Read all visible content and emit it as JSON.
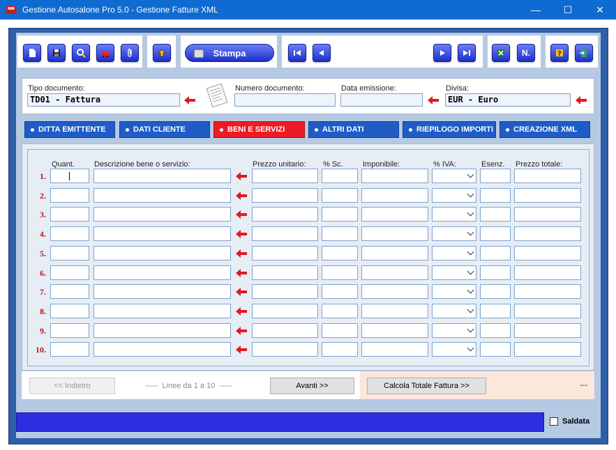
{
  "window": {
    "title": "Gestione Autosalone Pro 5.0 - Gestione Fatture XML",
    "minimize": "—",
    "maximize": "☐",
    "close": "✕"
  },
  "toolbar": {
    "print_label": "Stampa",
    "icons": [
      "new-document",
      "save",
      "search",
      "car",
      "attachment",
      "home-up",
      "first-record",
      "previous-record",
      "next-record",
      "last-record",
      "excel-export",
      "numbering",
      "help",
      "exit"
    ],
    "numbering_label": "N."
  },
  "header": {
    "doc_type": {
      "label": "Tipo documento:",
      "value": "TD01 - Fattura"
    },
    "doc_number": {
      "label": "Numero documento:",
      "value": ""
    },
    "issue_date": {
      "label": "Data emissione:",
      "value": ""
    },
    "currency": {
      "label": "Divisa:",
      "value": "EUR - Euro"
    }
  },
  "tabs": [
    {
      "label": "DITTA EMITTENTE",
      "active": false
    },
    {
      "label": "DATI CLIENTE",
      "active": false
    },
    {
      "label": "BENI E SERVIZI",
      "active": true
    },
    {
      "label": "ALTRI DATI",
      "active": false
    },
    {
      "label": "RIEPILOGO IMPORTI",
      "active": false
    },
    {
      "label": "CREAZIONE XML",
      "active": false
    }
  ],
  "grid": {
    "columns": {
      "quantity": "Quant.",
      "description": "Descrizione bene o servizio:",
      "unit_price": "Prezzo unitario:",
      "discount": "% Sc.",
      "taxable": "Imponibile:",
      "vat": "% IVA:",
      "exempt": "Esenz.",
      "total_price": "Prezzo totale:"
    },
    "rows": [
      "1.",
      "2.",
      "3.",
      "4.",
      "5.",
      "6.",
      "7.",
      "8.",
      "9.",
      "10."
    ]
  },
  "navigation": {
    "back_label": "<< Indietro",
    "lines_info": "-----  Linee da 1 a 10  -----",
    "forward_label": "Avanti >>",
    "calc_label": "Calcola Totale Fattura >>",
    "total_value": "---"
  },
  "footer": {
    "paid_label": "Saldata",
    "paid": false
  },
  "colors": {
    "titlebar": "#0f6ad1",
    "tab": "#1f5cc5",
    "tab_active": "#ed1c24",
    "status": "#2b2fdf"
  }
}
